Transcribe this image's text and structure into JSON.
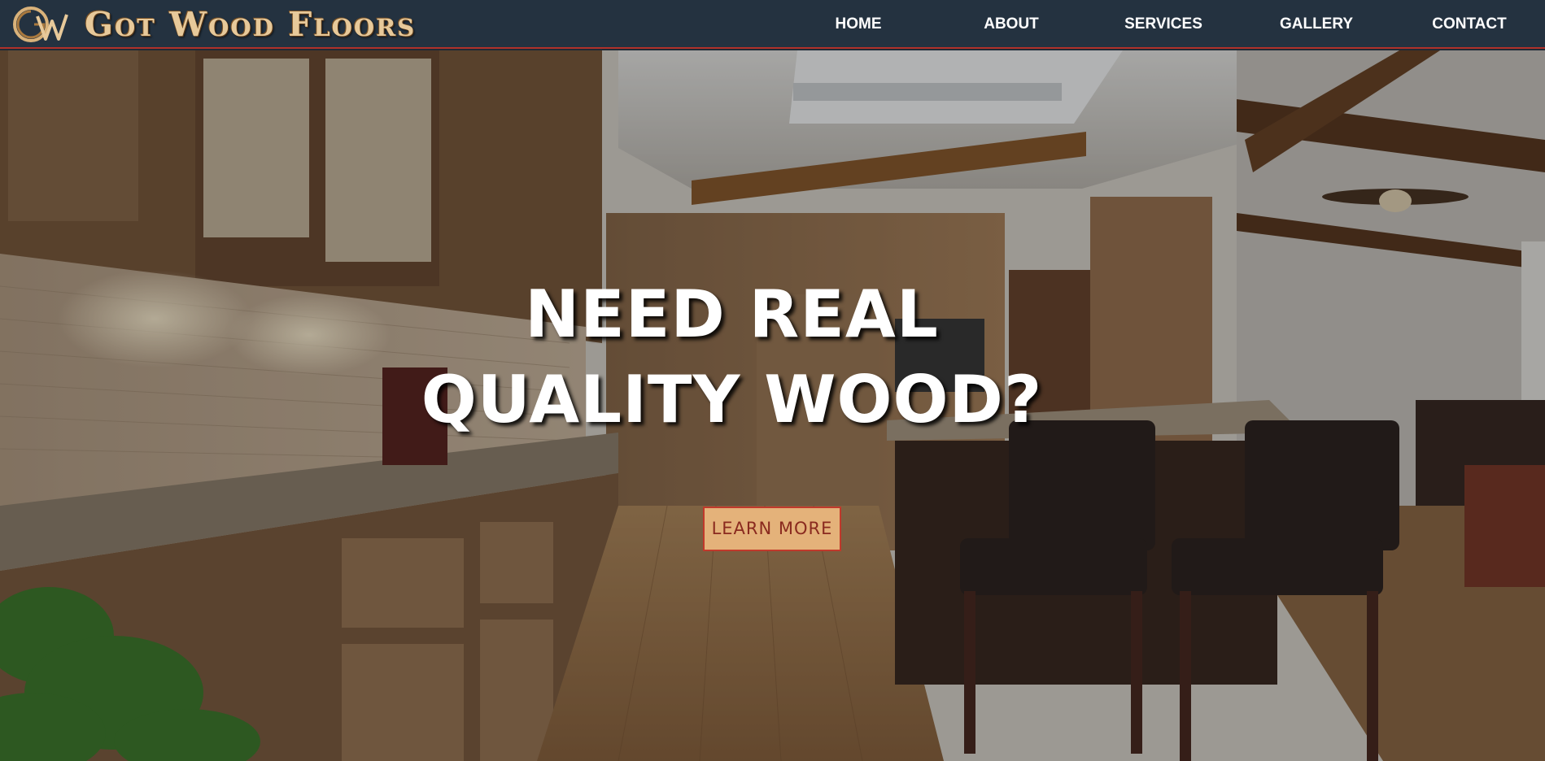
{
  "brand": {
    "logo_icon": "gw-monogram-logo",
    "name": "Got Wood Floors",
    "colors": {
      "brand_text": "#e7c99a",
      "navbar": "#243240",
      "accent_border": "#b0312a"
    }
  },
  "nav": {
    "items": [
      {
        "label": "HOME"
      },
      {
        "label": "ABOUT"
      },
      {
        "label": "SERVICES"
      },
      {
        "label": "GALLERY"
      },
      {
        "label": "CONTACT"
      }
    ]
  },
  "hero": {
    "background_image": "kitchen-interior-photo",
    "title_line1": "NEED REAL",
    "title_line2": "QUALITY WOOD?",
    "cta_label": "LEARN MORE",
    "colors": {
      "cta_bg": "#e4b27a",
      "cta_border": "#c0392b",
      "cta_text": "#8a2a1f"
    }
  }
}
